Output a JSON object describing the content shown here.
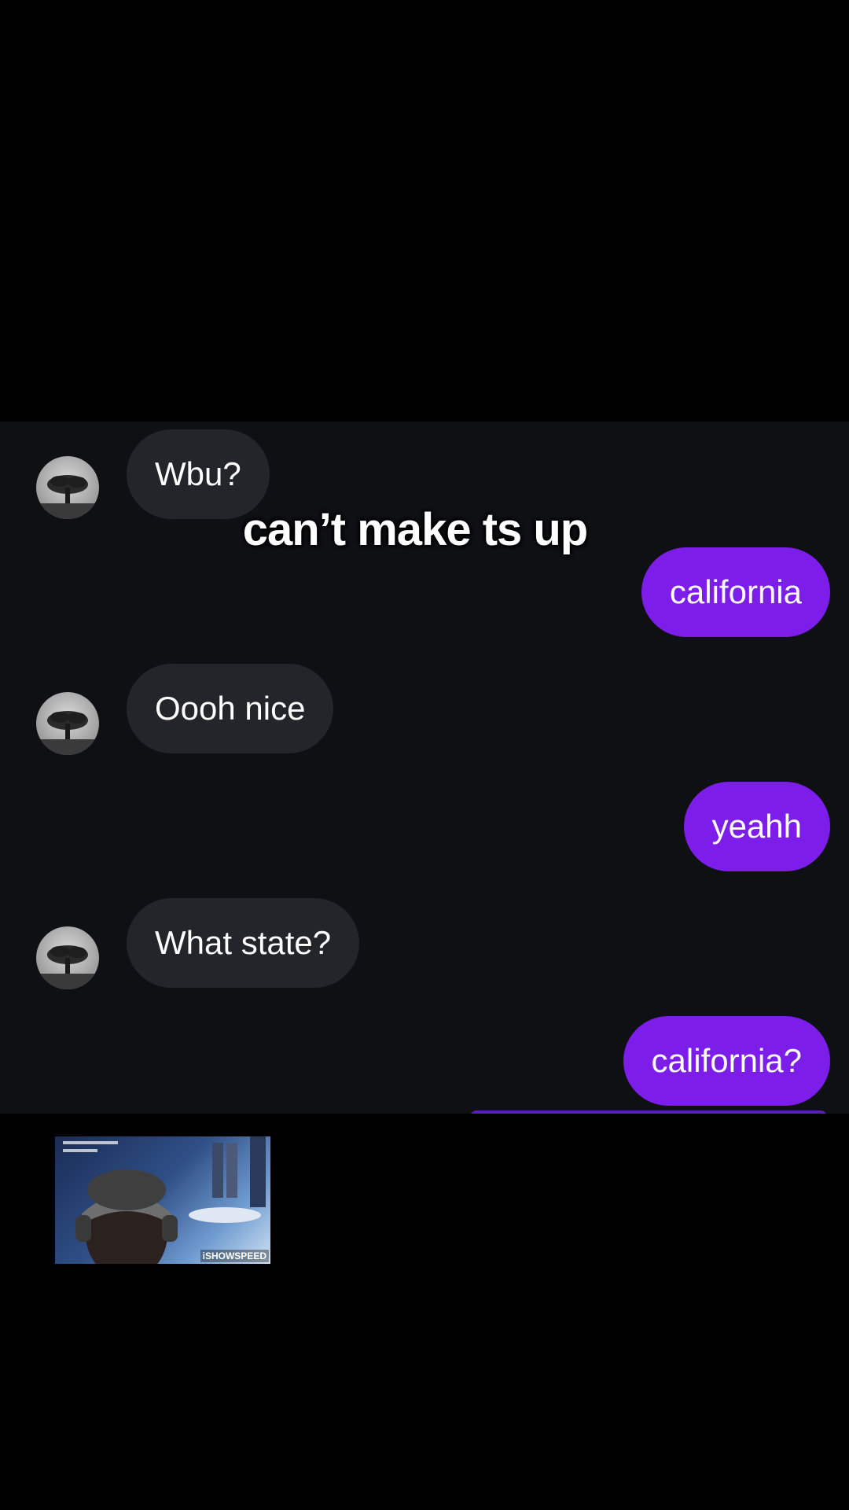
{
  "caption": "can’t make ts up",
  "messages": [
    {
      "direction": "incoming",
      "text": "Wbu?"
    },
    {
      "direction": "outgoing",
      "text": "california"
    },
    {
      "direction": "incoming",
      "text": "Oooh nice"
    },
    {
      "direction": "outgoing",
      "text": "yeahh"
    },
    {
      "direction": "incoming",
      "text": "What state?"
    },
    {
      "direction": "outgoing",
      "text": "california?"
    }
  ],
  "avatar_icon": "tree-icon",
  "colors": {
    "background": "#000000",
    "chat_background": "#0e1014",
    "incoming_bubble": "#23252b",
    "outgoing_bubble": "#7c1dea",
    "text": "#ffffff"
  },
  "stream_overlay": {
    "watermark": "iSHOWSPEED"
  }
}
